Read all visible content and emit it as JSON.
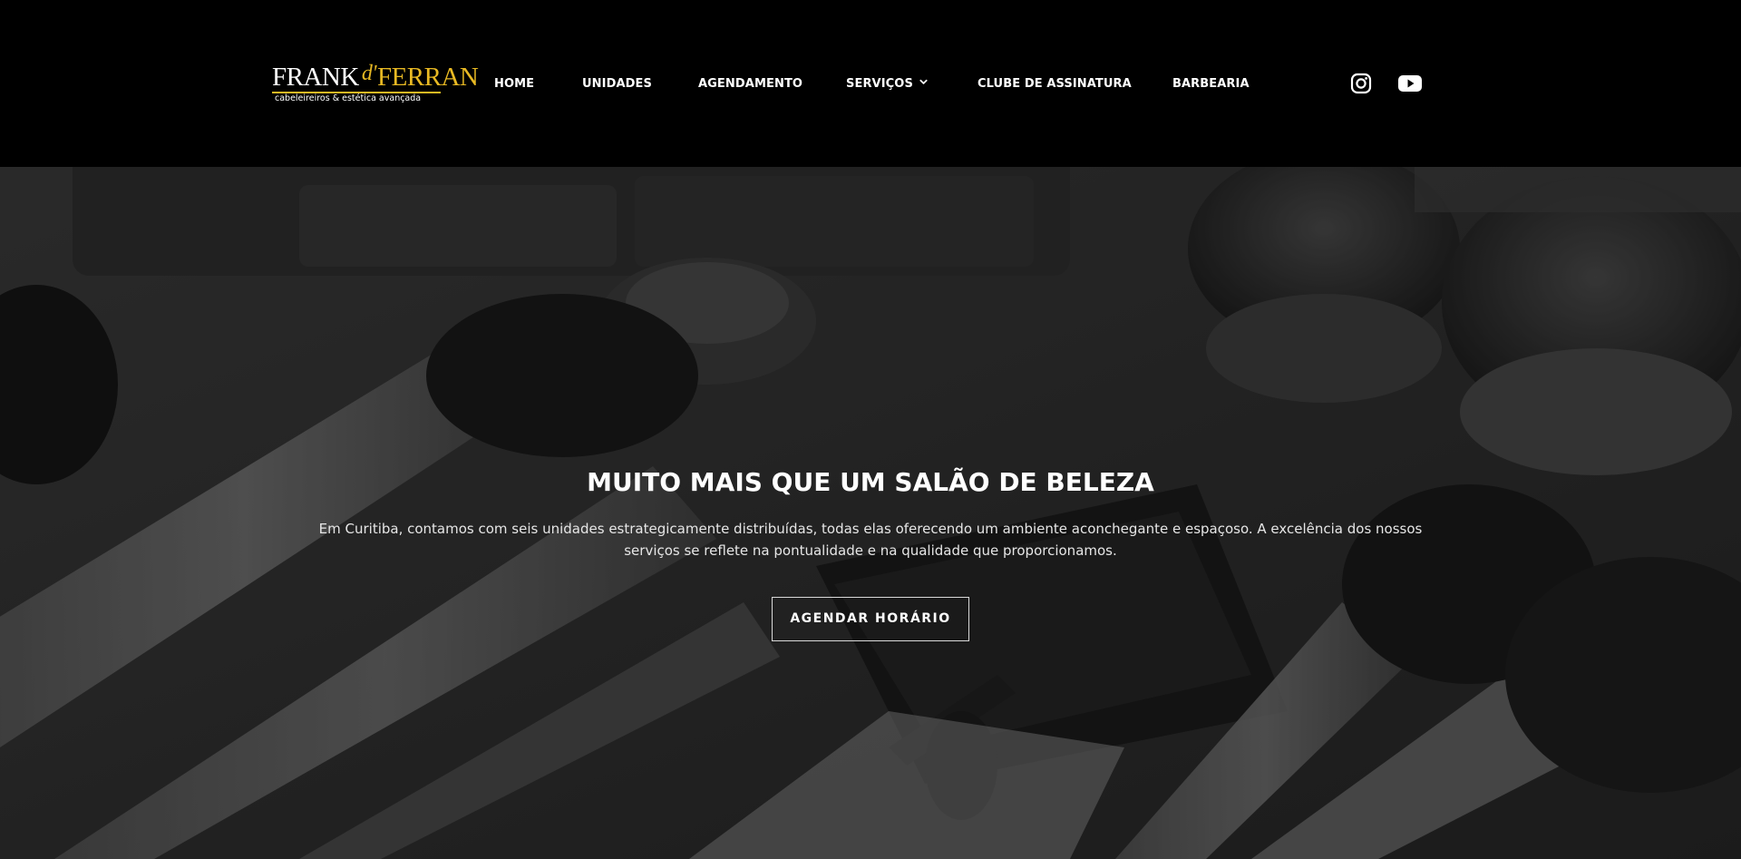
{
  "header": {
    "logo": {
      "name_part1": "FRANK",
      "name_d": "d'",
      "name_part2": "FERRAN",
      "tagline": "cabeleireiros & estética avançada"
    },
    "nav": {
      "home": "HOME",
      "unidades": "UNIDADES",
      "agendamento": "AGENDAMENTO",
      "servicos": "SERVIÇOS",
      "clube": "CLUBE DE ASSINATURA",
      "barbearia": "BARBEARIA"
    },
    "social": {
      "instagram_icon": "instagram-icon",
      "youtube_icon": "youtube-icon"
    }
  },
  "hero": {
    "title": "MUITO MAIS QUE UM SALÃO DE BELEZA",
    "text": "Em Curitiba, contamos com seis unidades estrategicamente distribuídas, todas elas oferecendo um ambiente aconchegante e espaçoso. A excelência dos nossos serviços se reflete na pontualidade e na qualidade que proporcionamos.",
    "button_label": "AGENDAR HORÁRIO"
  },
  "colors": {
    "background": "#000000",
    "brand_gold": "#e8b923",
    "text_white": "#ffffff"
  }
}
